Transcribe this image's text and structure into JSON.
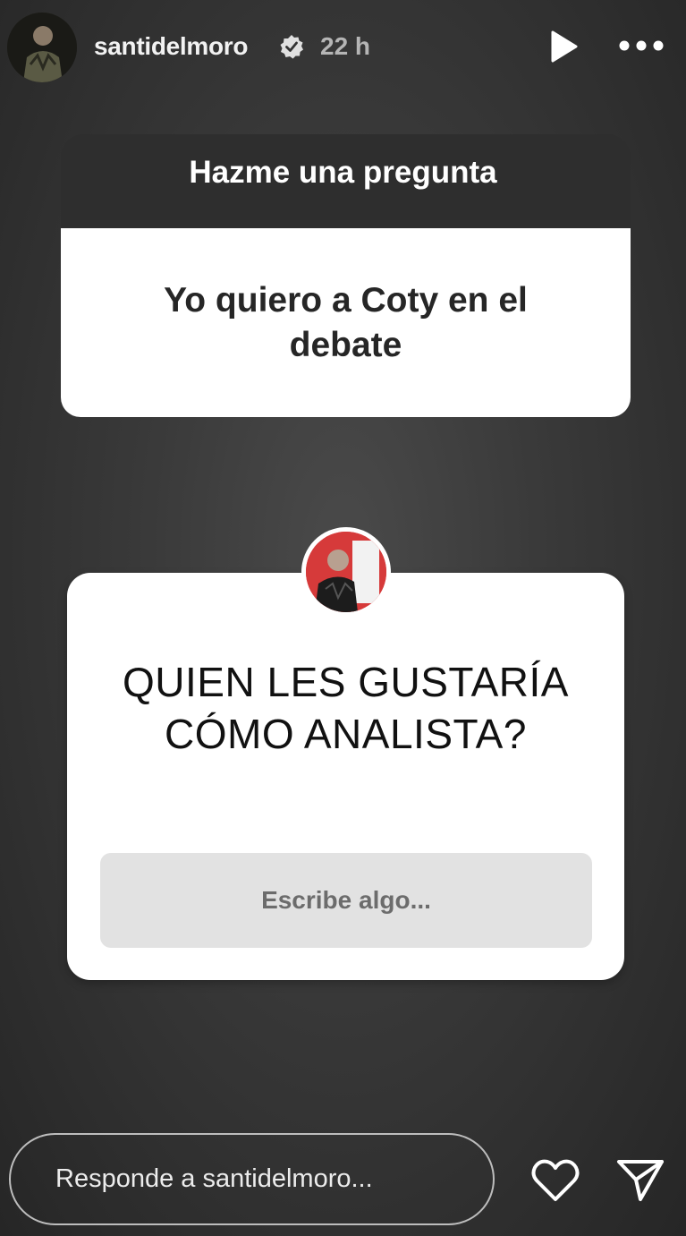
{
  "story": {
    "username": "santidelmoro",
    "verified_icon": "verified-badge-icon",
    "time_ago": "22 h",
    "play_icon": "play-icon",
    "more_icon": "more-horizontal-icon"
  },
  "question_sticker": {
    "header": "Hazme una pregunta",
    "answer": "Yo quiero a Coty en el debate"
  },
  "ask_sticker": {
    "question": "QUIEN LES GUSTARÍA CÓMO ANALISTA?",
    "input_placeholder": "Escribe algo..."
  },
  "footer": {
    "reply_placeholder": "Responde a santidelmoro...",
    "like_icon": "heart-icon",
    "send_icon": "send-icon"
  },
  "colors": {
    "background": "#3a3a3a",
    "card": "#ffffff",
    "input_bg": "#e2e2e2"
  }
}
